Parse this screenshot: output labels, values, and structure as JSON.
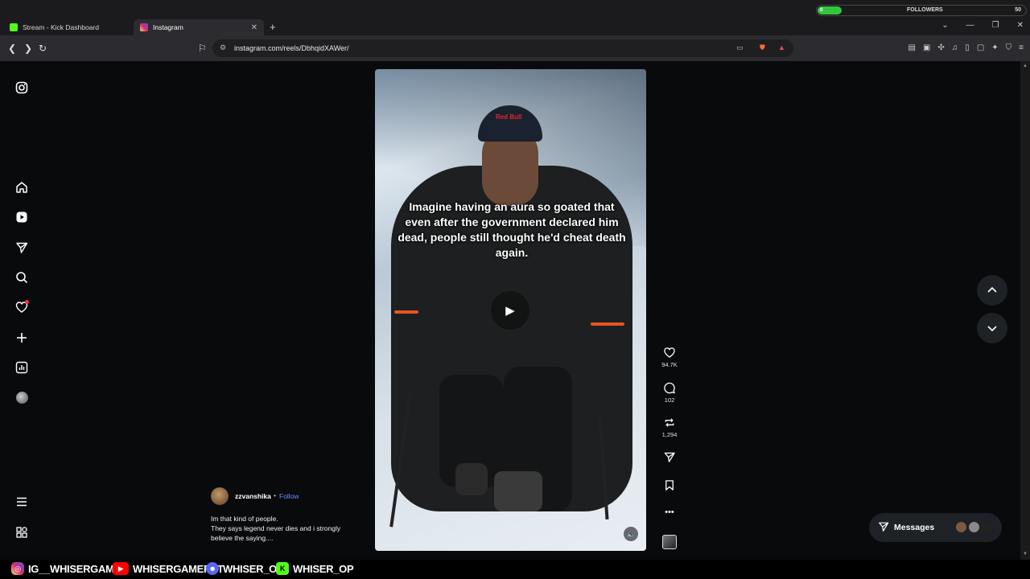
{
  "browser": {
    "tabs": [
      {
        "title": "Stream - Kick Dashboard",
        "active": false,
        "favicon_color": "#53fc18"
      },
      {
        "title": "Instagram",
        "active": true,
        "favicon_color": "#d62976"
      }
    ],
    "url": "instagram.com/reels/DbhqidXAWer/"
  },
  "followers_widget": {
    "left": "0",
    "label": "FOLLOWERS",
    "right": "50"
  },
  "reel": {
    "caption_overlay": "Imagine having an aura so goated that even after the government declared him dead, people still thought he'd cheat death again.",
    "cap_logo": "Red Bull"
  },
  "actions": {
    "likes": "94.7K",
    "comments": "102",
    "reposts": "1,294"
  },
  "author": {
    "username": "zzvanshika",
    "separator": "•",
    "follow_label": "Follow",
    "caption_lines": [
      "Im that kind of people.",
      "They says legend never dies and i strongly",
      "believe the saying...."
    ]
  },
  "messages": {
    "label": "Messages"
  },
  "stream_overlay": {
    "instagram": "IG__WHISERGAMER",
    "youtube": "WHISERGAMERYT",
    "discord": "WHISER_OP",
    "kick": "WHISER_OP"
  },
  "colors": {
    "accent_link": "#6b8cff",
    "notification": "#ff3040",
    "kick_green": "#53fc18"
  }
}
